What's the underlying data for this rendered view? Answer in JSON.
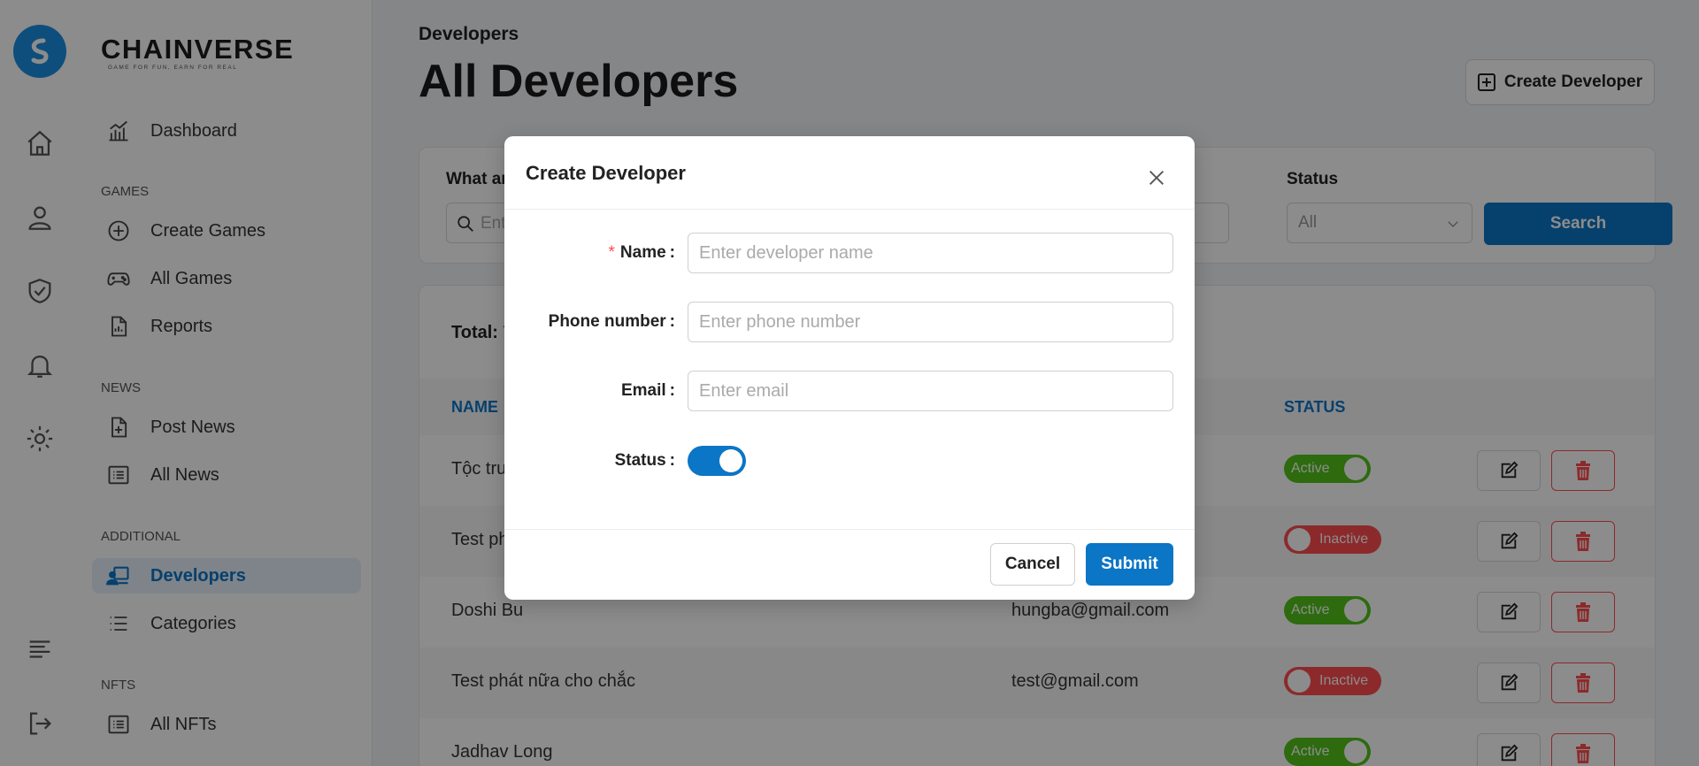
{
  "brand": {
    "name": "CHAINVERSE",
    "tagline": "GAME FOR FUN, EARN FOR REAL"
  },
  "rail": {
    "icons": [
      "logo-icon",
      "home-icon",
      "user-icon",
      "shield-check-icon",
      "bell-icon",
      "gear-icon",
      "menu-icon",
      "logout-icon"
    ]
  },
  "sidebar": {
    "dashboard": "Dashboard",
    "sections": {
      "games": "GAMES",
      "news": "NEWS",
      "additional": "ADDITIONAL",
      "nfts": "NFTS"
    },
    "items": {
      "create_games": "Create Games",
      "all_games": "All Games",
      "reports": "Reports",
      "post_news": "Post News",
      "all_news": "All News",
      "developers": "Developers",
      "categories": "Categories",
      "all_nfts": "All NFTs"
    }
  },
  "header": {
    "breadcrumb": "Developers",
    "title": "All Developers",
    "create_button": "Create Developer"
  },
  "filters": {
    "question": "What ar",
    "search_placeholder": "Ent",
    "status_label": "Status",
    "status_value": "All",
    "search_button": "Search"
  },
  "table": {
    "total_label": "Total:",
    "total_partial": "7",
    "columns": {
      "name": "NAME",
      "status": "STATUS"
    },
    "rows": [
      {
        "name": "Tộc tru",
        "email": "",
        "status": "Active"
      },
      {
        "name": "Test ph",
        "email": "",
        "status": "Inactive"
      },
      {
        "name": "Doshi Bu",
        "email": "hungba@gmail.com",
        "status": "Active"
      },
      {
        "name": "Test phát nữa cho chắc",
        "email": "test@gmail.com",
        "status": "Inactive"
      },
      {
        "name": "Jadhav Long",
        "email": "",
        "status": "Active"
      }
    ]
  },
  "modal": {
    "title": "Create Developer",
    "fields": {
      "name": {
        "label": "Name",
        "placeholder": "Enter developer name",
        "required": true
      },
      "phone": {
        "label": "Phone number",
        "placeholder": "Enter phone number"
      },
      "email": {
        "label": "Email",
        "placeholder": "Enter email"
      },
      "status": {
        "label": "Status",
        "enabled": true
      }
    },
    "colon": ":",
    "required_mark": "*",
    "cancel_button": "Cancel",
    "submit_button": "Submit"
  },
  "colors": {
    "accent": "#0b75c6",
    "active": "#52c41a",
    "inactive": "#ff4d4f"
  }
}
